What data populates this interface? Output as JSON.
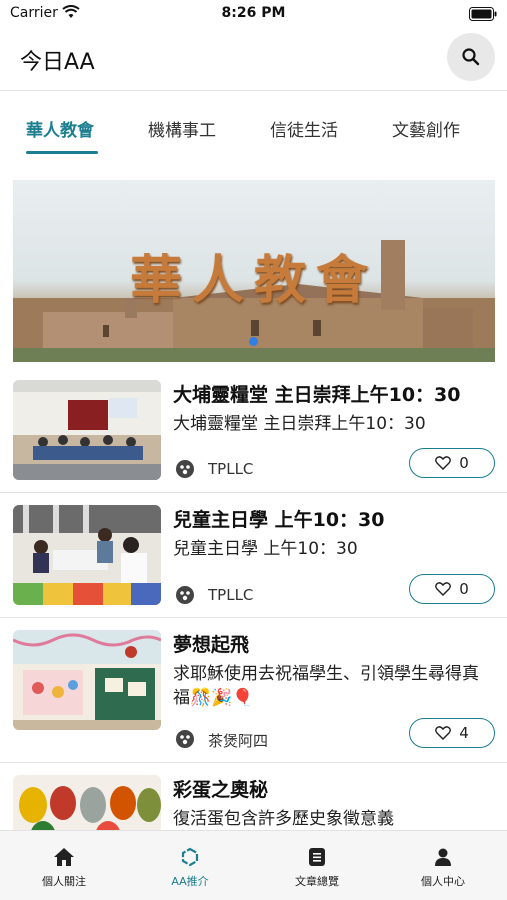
{
  "status_bar": {
    "carrier": "Carrier",
    "time": "8:26 PM"
  },
  "header": {
    "title": "今日AA",
    "search_icon": "search-icon"
  },
  "tabs": [
    {
      "label": "華人教會",
      "active": true
    },
    {
      "label": "機構事工",
      "active": false
    },
    {
      "label": "信徒生活",
      "active": false
    },
    {
      "label": "文藝創作",
      "active": false
    }
  ],
  "banner": {
    "title": "華人教會"
  },
  "articles": [
    {
      "title": "大埔靈糧堂 主日崇拜上午10：30",
      "description": "大埔靈糧堂 主日崇拜上午10：30",
      "author": "TPLLC",
      "likes": "0"
    },
    {
      "title": "兒童主日學 上午10：30",
      "description": "兒童主日學 上午10：30",
      "author": "TPLLC",
      "likes": "0"
    },
    {
      "title": "夢想起飛",
      "description": "求耶穌使用去祝福學生、引領學生尋得真福🎊🎉🎈",
      "author": "茶煲阿四",
      "likes": "4"
    },
    {
      "title": "彩蛋之奧秘",
      "description": "復活蛋包含許多歷史象徵意義",
      "author": "",
      "likes": ""
    }
  ],
  "bottom_nav": [
    {
      "label": "個人關注",
      "icon": "home-icon",
      "active": false
    },
    {
      "label": "AA推介",
      "icon": "hexagon-icon",
      "active": true
    },
    {
      "label": "文章總覽",
      "icon": "document-icon",
      "active": false
    },
    {
      "label": "個人中心",
      "icon": "person-icon",
      "active": false
    }
  ],
  "colors": {
    "accent": "#1b7f8f",
    "banner_text": "#c67b3a"
  }
}
